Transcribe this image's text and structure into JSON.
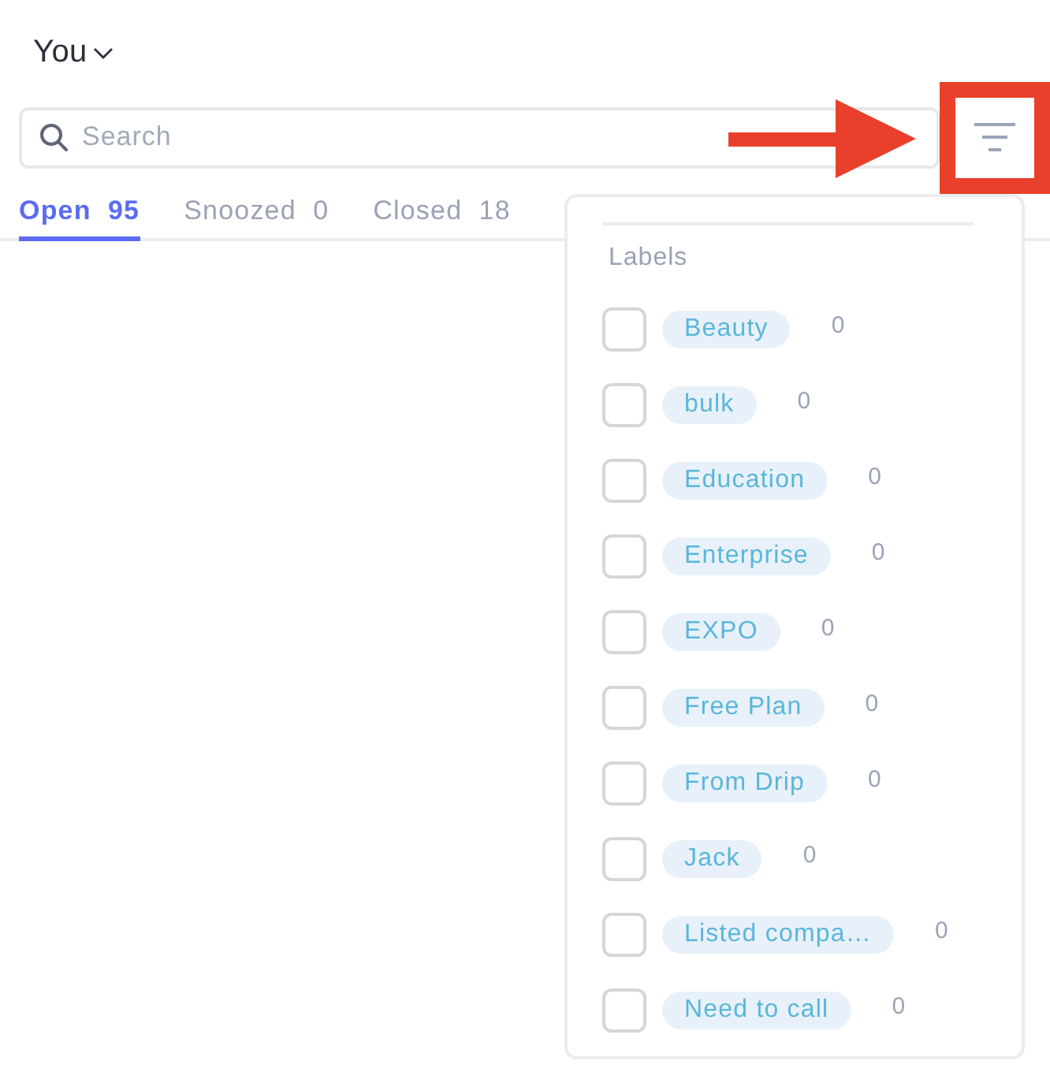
{
  "header": {
    "title": "You"
  },
  "search": {
    "placeholder": "Search"
  },
  "tabs": [
    {
      "label": "Open",
      "count": "95",
      "selected": true
    },
    {
      "label": "Snoozed",
      "count": "0",
      "selected": false
    },
    {
      "label": "Closed",
      "count": "18",
      "selected": false
    }
  ],
  "filter_menu": {
    "heading": "Labels",
    "labels": [
      {
        "name": "Beauty",
        "count": "0",
        "checked": false
      },
      {
        "name": "bulk",
        "count": "0",
        "checked": false
      },
      {
        "name": "Education",
        "count": "0",
        "checked": false
      },
      {
        "name": "Enterprise",
        "count": "0",
        "checked": false
      },
      {
        "name": "EXPO",
        "count": "0",
        "checked": false
      },
      {
        "name": "Free Plan",
        "count": "0",
        "checked": false
      },
      {
        "name": "From Drip",
        "count": "0",
        "checked": false
      },
      {
        "name": "Jack",
        "count": "0",
        "checked": false
      },
      {
        "name": "Listed compa…",
        "count": "0",
        "checked": false
      },
      {
        "name": "Need to call",
        "count": "0",
        "checked": false
      }
    ]
  }
}
